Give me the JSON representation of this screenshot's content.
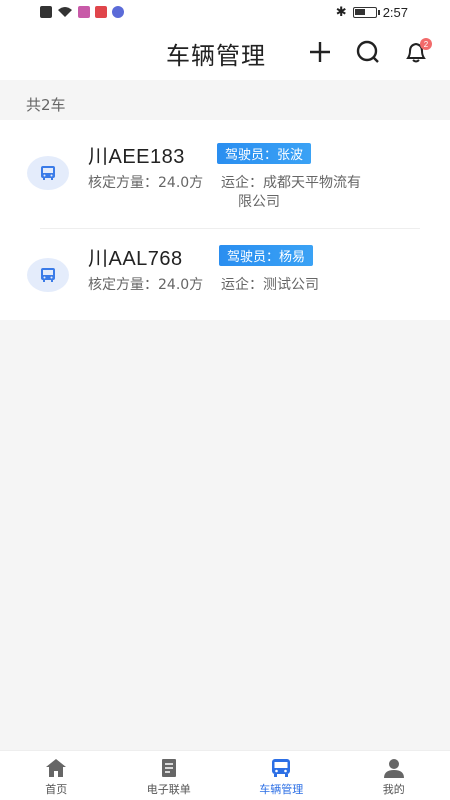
{
  "status": {
    "time": "2:57"
  },
  "header": {
    "title": "车辆管理",
    "notification_count": "2"
  },
  "summary": {
    "count_text": "共2车"
  },
  "vehicles": [
    {
      "plate": "川AEE183",
      "driver_label": "驾驶员：",
      "driver": "张波",
      "capacity_label": "核定方量：",
      "capacity": "24.0方",
      "carrier_label": "运企：",
      "carrier_line1": "成都天平物流有",
      "carrier_line2": "限公司"
    },
    {
      "plate": "川AAL768",
      "driver_label": "驾驶员：",
      "driver": "杨易",
      "capacity_label": "核定方量：",
      "capacity": "24.0方",
      "carrier_label": "运企：",
      "carrier_line1": "测试公司",
      "carrier_line2": ""
    }
  ],
  "tabs": [
    {
      "label": "首页",
      "icon": "home-icon"
    },
    {
      "label": "电子联单",
      "icon": "document-icon"
    },
    {
      "label": "车辆管理",
      "icon": "bus-icon"
    },
    {
      "label": "我的",
      "icon": "user-icon"
    }
  ],
  "colors": {
    "accent": "#2c6fe5",
    "tag_blue": "#2a8ef0",
    "badge": "#f26b6b"
  },
  "battery_level": 0.55
}
